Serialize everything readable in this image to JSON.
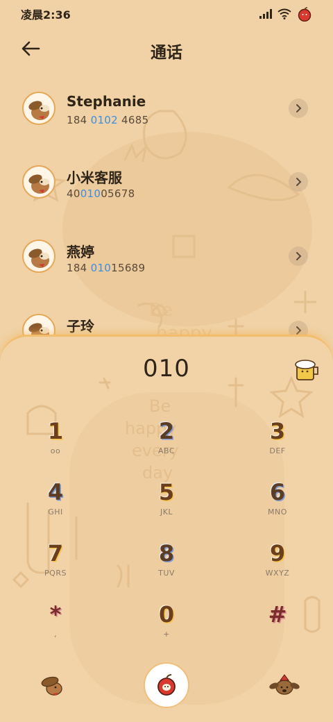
{
  "status_bar": {
    "time": "凌晨2:36",
    "signal_icon": "signal-icon",
    "wifi_icon": "wifi-icon",
    "battery_icon": "apple-battery-icon"
  },
  "header": {
    "back_icon": "back-arrow-icon",
    "title": "通话"
  },
  "contacts": [
    {
      "name": "Stephanie",
      "number_prefix": "184 ",
      "number_match": "0102",
      "number_suffix": " 4685"
    },
    {
      "name": "小米客服",
      "number_prefix": "40",
      "number_match": "010",
      "number_suffix": "05678"
    },
    {
      "name": "燕婷",
      "number_prefix": "184 ",
      "number_match": "010",
      "number_suffix": "15689"
    },
    {
      "name": "子玲",
      "number_prefix": "",
      "number_match": "",
      "number_suffix": ""
    }
  ],
  "dialer": {
    "entered_number": "010",
    "keys": [
      {
        "digit": "1",
        "sub": "ᴏᴏ"
      },
      {
        "digit": "2",
        "sub": "ABC"
      },
      {
        "digit": "3",
        "sub": "DEF"
      },
      {
        "digit": "4",
        "sub": "GHI"
      },
      {
        "digit": "5",
        "sub": "JKL"
      },
      {
        "digit": "6",
        "sub": "MNO"
      },
      {
        "digit": "7",
        "sub": "PQRS"
      },
      {
        "digit": "8",
        "sub": "TUV"
      },
      {
        "digit": "9",
        "sub": "WXYZ"
      },
      {
        "digit": "*",
        "sub": ","
      },
      {
        "digit": "0",
        "sub": "+"
      },
      {
        "digit": "#",
        "sub": ""
      }
    ]
  },
  "colors": {
    "background": "#f0d2a6",
    "highlight": "#3b8ee0",
    "digit": "#6b3f1e",
    "panel_border": "#f3bd6e"
  }
}
